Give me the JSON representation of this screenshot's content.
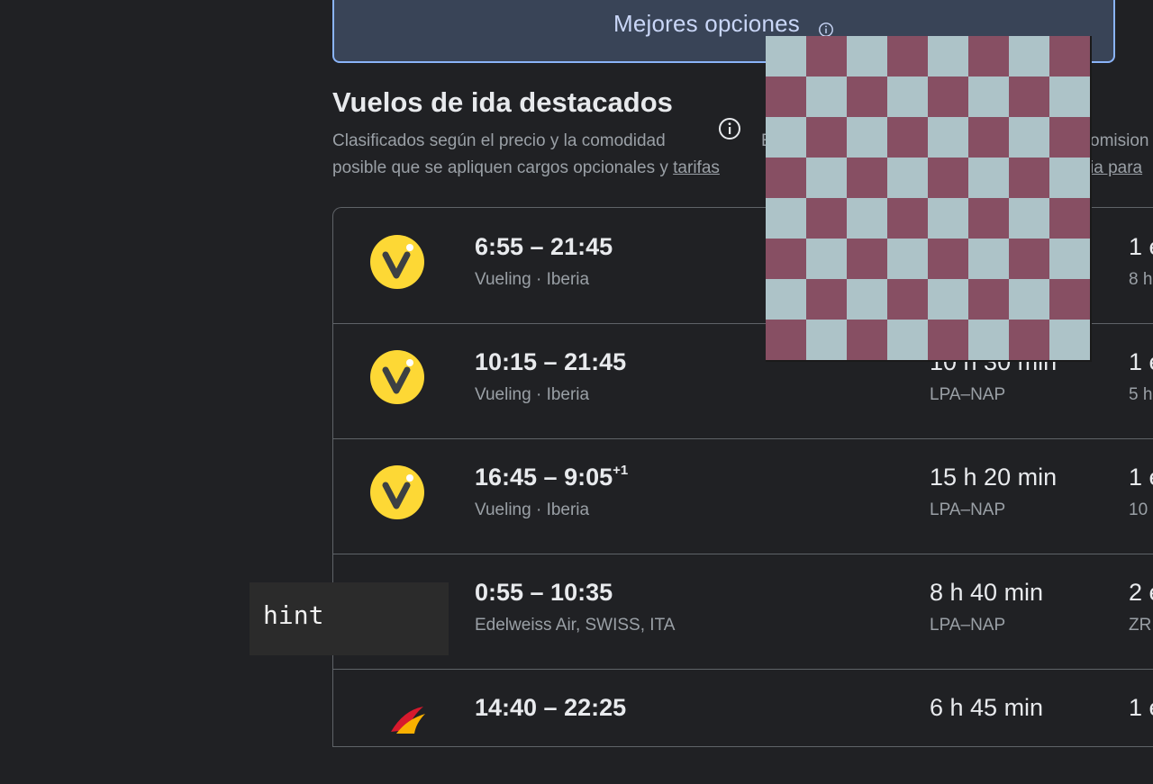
{
  "best_tab": {
    "label": "Mejores opciones"
  },
  "section": {
    "title": "Vuelos de ida destacados",
    "subtitle_line1": "Clasificados según el precio y la comodidad",
    "subtitle_line1_right_a": "E",
    "subtitle_line1_right_b": "omision",
    "subtitle_line2_prefix": "posible que se apliquen cargos opcionales y ",
    "subtitle_line2_link": "tarifas",
    "subtitle_line2_right": "ia para"
  },
  "flights": [
    {
      "times": "6:55 – 21:45",
      "day_offset": "",
      "airlines": "Vueling · Iberia",
      "duration": "",
      "route": "",
      "stops": "1 e",
      "stops_detail": "8 h"
    },
    {
      "times": "10:15 – 21:45",
      "day_offset": "",
      "airlines": "Vueling · Iberia",
      "duration": "10 h 30 min",
      "route": "LPA–NAP",
      "stops": "1 e",
      "stops_detail": "5 h"
    },
    {
      "times": "16:45 – 9:05",
      "day_offset": "+1",
      "airlines": "Vueling · Iberia",
      "duration": "15 h 20 min",
      "route": "LPA–NAP",
      "stops": "1 e",
      "stops_detail": "10"
    },
    {
      "times": "0:55 – 10:35",
      "day_offset": "",
      "airlines": "Edelweiss Air, SWISS, ITA",
      "duration": "8 h 40 min",
      "route": "LPA–NAP",
      "stops": "2 e",
      "stops_detail": "ZR"
    },
    {
      "times": "14:40 – 22:25",
      "day_offset": "",
      "airlines": "",
      "duration": "6 h 45 min",
      "route": "",
      "stops": "1 e",
      "stops_detail": ""
    }
  ],
  "logos": [
    "vueling-logo",
    "vueling-logo",
    "vueling-logo",
    "",
    "iberia-logo"
  ],
  "overlay": {
    "hint_text": "hint",
    "checker_colors": [
      "#adc3c8",
      "#874f63"
    ]
  },
  "colors": {
    "accent": "#8ab4f8",
    "vueling_yellow": "#fdd835",
    "background": "#202124"
  }
}
